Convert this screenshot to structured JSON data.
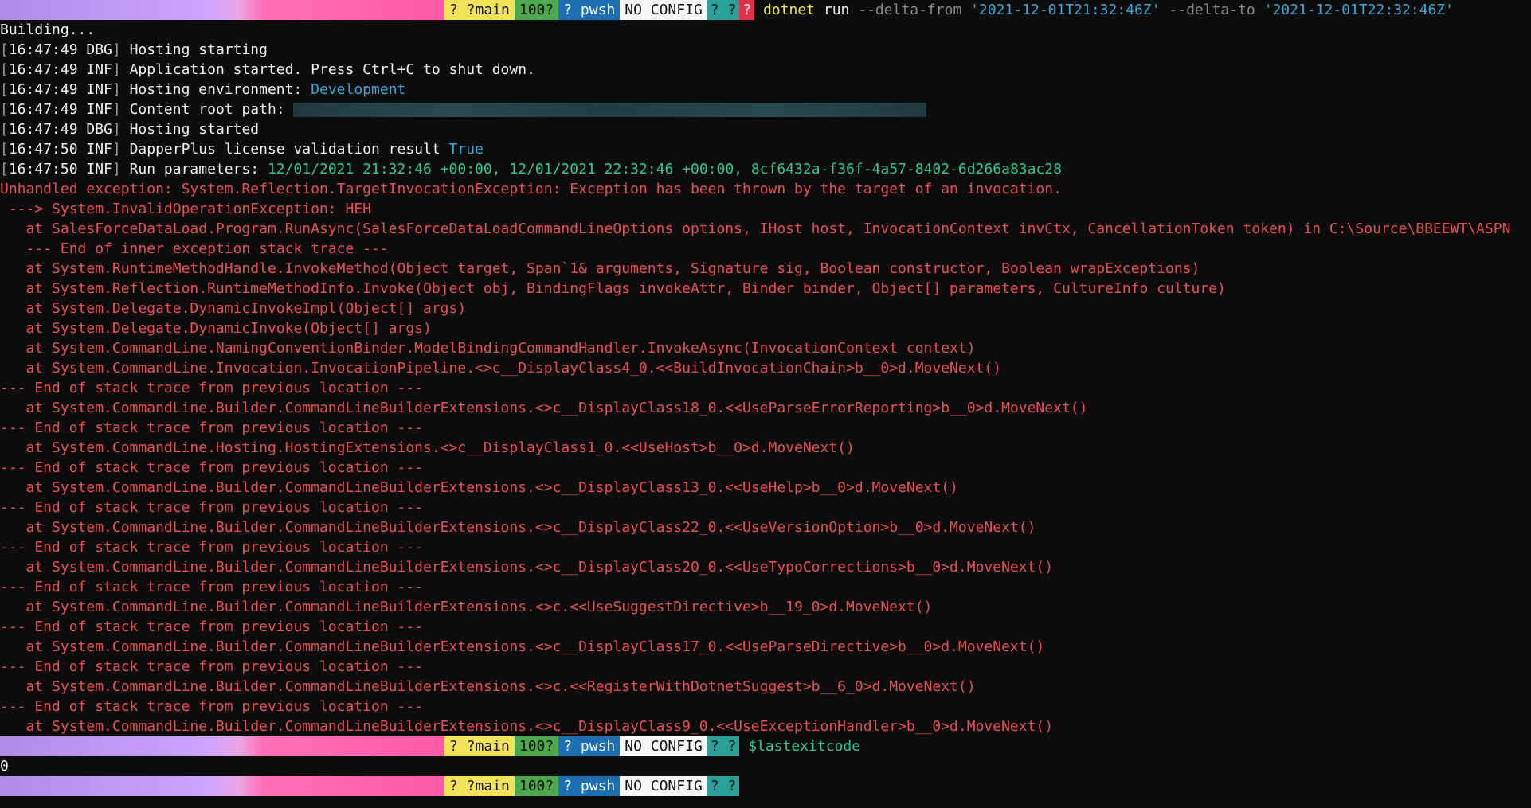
{
  "prompt": {
    "git_icon": "?",
    "branch": "?main",
    "percent": "100?",
    "shell_icon": "?",
    "shell": "pwsh",
    "config": "NO CONFIG",
    "sep1": "?",
    "sep2": "?",
    "sep3": "?",
    "error_icon": "?"
  },
  "command1": {
    "word": "dotnet",
    "arg": "run",
    "flag_from": "--delta-from",
    "from_value": "'2021-12-01T21:32:46Z'",
    "flag_to": "--delta-to",
    "to_value": "'2021-12-01T22:32:46Z'"
  },
  "building": "Building...",
  "logs": [
    {
      "time": "16:47:49",
      "level": "DBG",
      "msg": "Hosting starting",
      "extra": ""
    },
    {
      "time": "16:47:49",
      "level": "INF",
      "msg": "Application started. Press Ctrl+C to shut down.",
      "extra": ""
    },
    {
      "time": "16:47:49",
      "level": "INF",
      "msg": "Hosting environment: ",
      "extra": "Development"
    },
    {
      "time": "16:47:49",
      "level": "INF",
      "msg": "Content root path: ",
      "extra": ""
    },
    {
      "time": "16:47:49",
      "level": "DBG",
      "msg": "Hosting started",
      "extra": ""
    },
    {
      "time": "16:47:50",
      "level": "INF",
      "msg": "DapperPlus license validation result ",
      "extra": "True"
    },
    {
      "time": "16:47:50",
      "level": "INF",
      "msg": "Run parameters: ",
      "extra": "12/01/2021 21:32:46 +00:00, 12/01/2021 22:32:46 +00:00, 8cf6432a-f36f-4a57-8402-6d266a83ac28"
    }
  ],
  "errors": [
    "Unhandled exception: System.Reflection.TargetInvocationException: Exception has been thrown by the target of an invocation.",
    " ---> System.InvalidOperationException: HEH",
    "   at SalesForceDataLoad.Program.RunAsync(SalesForceDataLoadCommandLineOptions options, IHost host, InvocationContext invCtx, CancellationToken token) in C:\\Source\\BBEEWT\\ASPN",
    "   --- End of inner exception stack trace ---",
    "   at System.RuntimeMethodHandle.InvokeMethod(Object target, Span`1& arguments, Signature sig, Boolean constructor, Boolean wrapExceptions)",
    "   at System.Reflection.RuntimeMethodInfo.Invoke(Object obj, BindingFlags invokeAttr, Binder binder, Object[] parameters, CultureInfo culture)",
    "   at System.Delegate.DynamicInvokeImpl(Object[] args)",
    "   at System.Delegate.DynamicInvoke(Object[] args)",
    "   at System.CommandLine.NamingConventionBinder.ModelBindingCommandHandler.InvokeAsync(InvocationContext context)",
    "   at System.CommandLine.Invocation.InvocationPipeline.<>c__DisplayClass4_0.<<BuildInvocationChain>b__0>d.MoveNext()",
    "--- End of stack trace from previous location ---",
    "   at System.CommandLine.Builder.CommandLineBuilderExtensions.<>c__DisplayClass18_0.<<UseParseErrorReporting>b__0>d.MoveNext()",
    "--- End of stack trace from previous location ---",
    "   at System.CommandLine.Hosting.HostingExtensions.<>c__DisplayClass1_0.<<UseHost>b__0>d.MoveNext()",
    "--- End of stack trace from previous location ---",
    "   at System.CommandLine.Builder.CommandLineBuilderExtensions.<>c__DisplayClass13_0.<<UseHelp>b__0>d.MoveNext()",
    "--- End of stack trace from previous location ---",
    "   at System.CommandLine.Builder.CommandLineBuilderExtensions.<>c__DisplayClass22_0.<<UseVersionOption>b__0>d.MoveNext()",
    "--- End of stack trace from previous location ---",
    "   at System.CommandLine.Builder.CommandLineBuilderExtensions.<>c__DisplayClass20_0.<<UseTypoCorrections>b__0>d.MoveNext()",
    "--- End of stack trace from previous location ---",
    "   at System.CommandLine.Builder.CommandLineBuilderExtensions.<>c.<<UseSuggestDirective>b__19_0>d.MoveNext()",
    "--- End of stack trace from previous location ---",
    "   at System.CommandLine.Builder.CommandLineBuilderExtensions.<>c__DisplayClass17_0.<<UseParseDirective>b__0>d.MoveNext()",
    "--- End of stack trace from previous location ---",
    "   at System.CommandLine.Builder.CommandLineBuilderExtensions.<>c.<<RegisterWithDotnetSuggest>b__6_0>d.MoveNext()",
    "--- End of stack trace from previous location ---",
    "   at System.CommandLine.Builder.CommandLineBuilderExtensions.<>c__DisplayClass9_0.<<UseExceptionHandler>b__0>d.MoveNext()"
  ],
  "command2": "$lastexitcode",
  "exit_output": "0"
}
